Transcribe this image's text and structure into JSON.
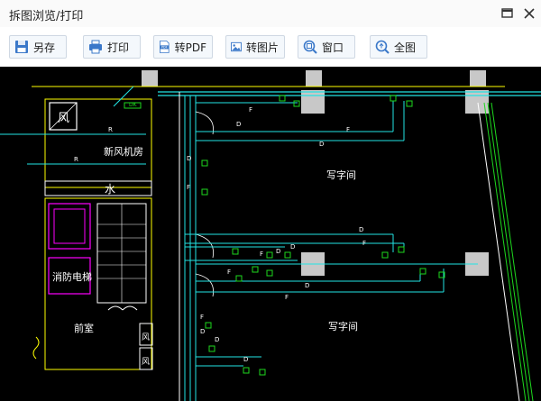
{
  "window": {
    "title": "拆图浏览/打印"
  },
  "toolbar": {
    "buttons": [
      {
        "id": "save-as",
        "label": "另存",
        "icon": "save-icon"
      },
      {
        "id": "print",
        "label": "打印",
        "icon": "printer-icon"
      },
      {
        "id": "to-pdf",
        "label": "转PDF",
        "icon": "pdf-icon"
      },
      {
        "id": "to-image",
        "label": "转图片",
        "icon": "image-icon"
      },
      {
        "id": "window",
        "label": "窗口",
        "icon": "zoom-window-icon"
      },
      {
        "id": "full-view",
        "label": "全图",
        "icon": "zoom-extents-icon"
      }
    ]
  },
  "drawing": {
    "room_labels": {
      "fan_room": "新风机房",
      "office_top": "写字间",
      "office_bottom": "写字间",
      "water": "水",
      "fire_elevator": "消防电梯",
      "lobby": "前室",
      "wind_top": "风",
      "wind_bottom_1": "风",
      "wind_bottom_2": "风"
    },
    "pipe_labels": {
      "R": "R",
      "D": "D",
      "F": "F",
      "DK": "DK"
    },
    "colors": {
      "background": "#000000",
      "wall": "#ffffff",
      "pipe_cyan": "#22e3e3",
      "pipe_green": "#1ed81e",
      "room_yellow": "#ffff00",
      "elevator_magenta": "#ff00ff",
      "column": "#c8c8c8"
    }
  }
}
